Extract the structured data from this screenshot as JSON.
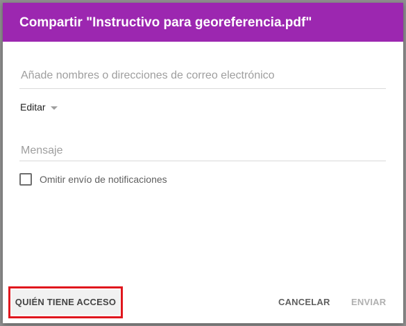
{
  "dialog": {
    "title": "Compartir \"Instructivo para georeferencia.pdf\"",
    "recipients_placeholder": "Añade nombres o direcciones de correo electrónico",
    "permission_label": "Editar",
    "message_placeholder": "Mensaje",
    "skip_notifications_label": "Omitir envío de notificaciones",
    "skip_notifications_checked": false,
    "who_has_access_button": "QUIÉN TIENE ACCESO",
    "cancel_button": "CANCELAR",
    "send_button": "ENVIAR"
  },
  "colors": {
    "header": "#9c27b0",
    "highlight": "#e0161d",
    "send_disabled": "#b0b0b0"
  }
}
